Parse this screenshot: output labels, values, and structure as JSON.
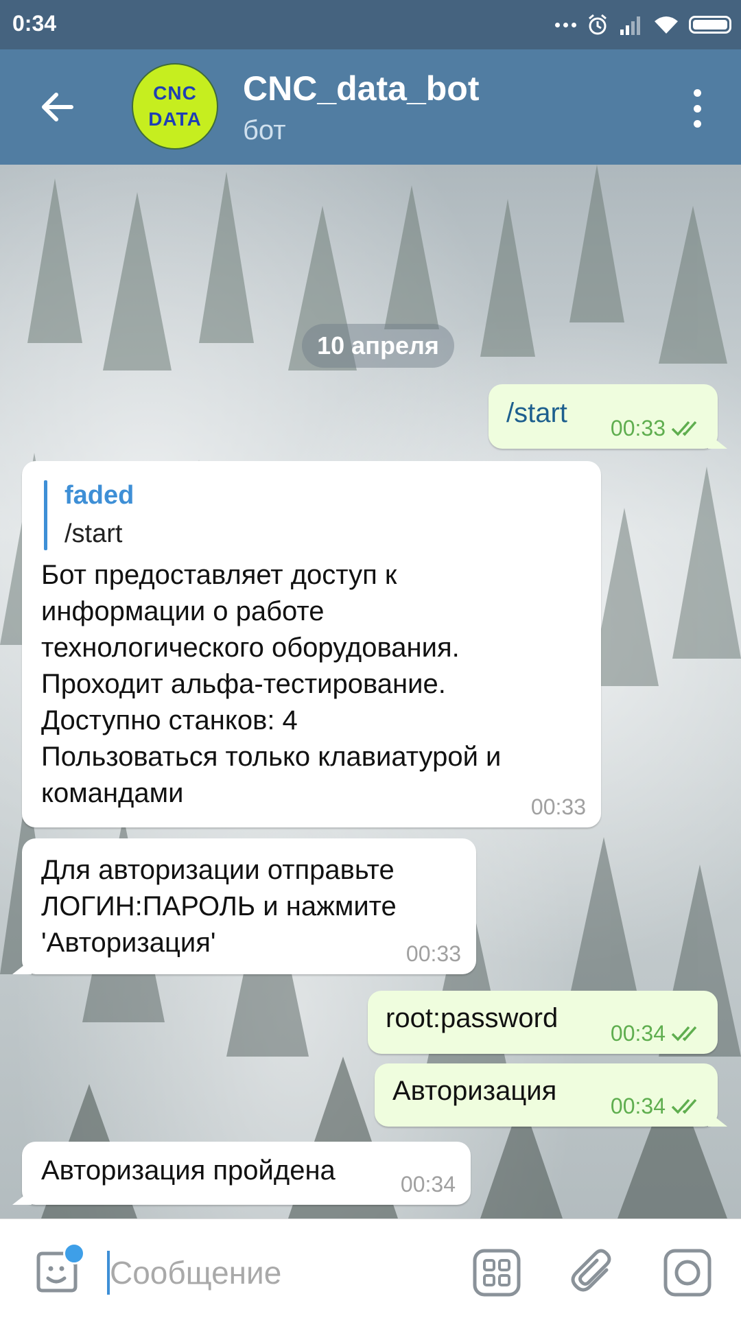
{
  "status_bar": {
    "time": "0:34"
  },
  "header": {
    "title": "CNC_data_bot",
    "subtitle": "бот",
    "avatar_line1": "CNC",
    "avatar_line2": "DATA"
  },
  "chat": {
    "date_label": "10 апреля",
    "messages": [
      {
        "dir": "out",
        "text": "/start",
        "time": "00:33"
      },
      {
        "dir": "in",
        "reply_to_name": "faded",
        "reply_to_text": "/start",
        "text": "Бот предоставляет доступ к\nинформации о работе\nтехнологического оборудования.\nПроходит альфа-тестирование.\nДоступно станков: 4\nПользоваться только клавиатурой и\nкомандами",
        "time": "00:33"
      },
      {
        "dir": "in",
        "text": "Для авторизации отправьте\nЛОГИН:ПАРОЛЬ и нажмите\n'Авторизация'",
        "time": "00:33"
      },
      {
        "dir": "out",
        "text": "root:password",
        "time": "00:34"
      },
      {
        "dir": "out",
        "text": "Авторизация",
        "time": "00:34"
      },
      {
        "dir": "in",
        "text": "Авторизация пройдена",
        "time": "00:34"
      }
    ]
  },
  "input": {
    "placeholder": "Сообщение"
  },
  "colors": {
    "header": "#517da2",
    "status_bar": "#45637f",
    "outgoing_bubble": "#effdde",
    "accent": "#3e8fd6",
    "avatar_bg": "#c6ee1f"
  },
  "icons": [
    "back-arrow-icon",
    "more-vert-icon",
    "sticker-icon",
    "keyboard-grid-icon",
    "paperclip-icon",
    "camera-icon",
    "double-check-icon"
  ]
}
